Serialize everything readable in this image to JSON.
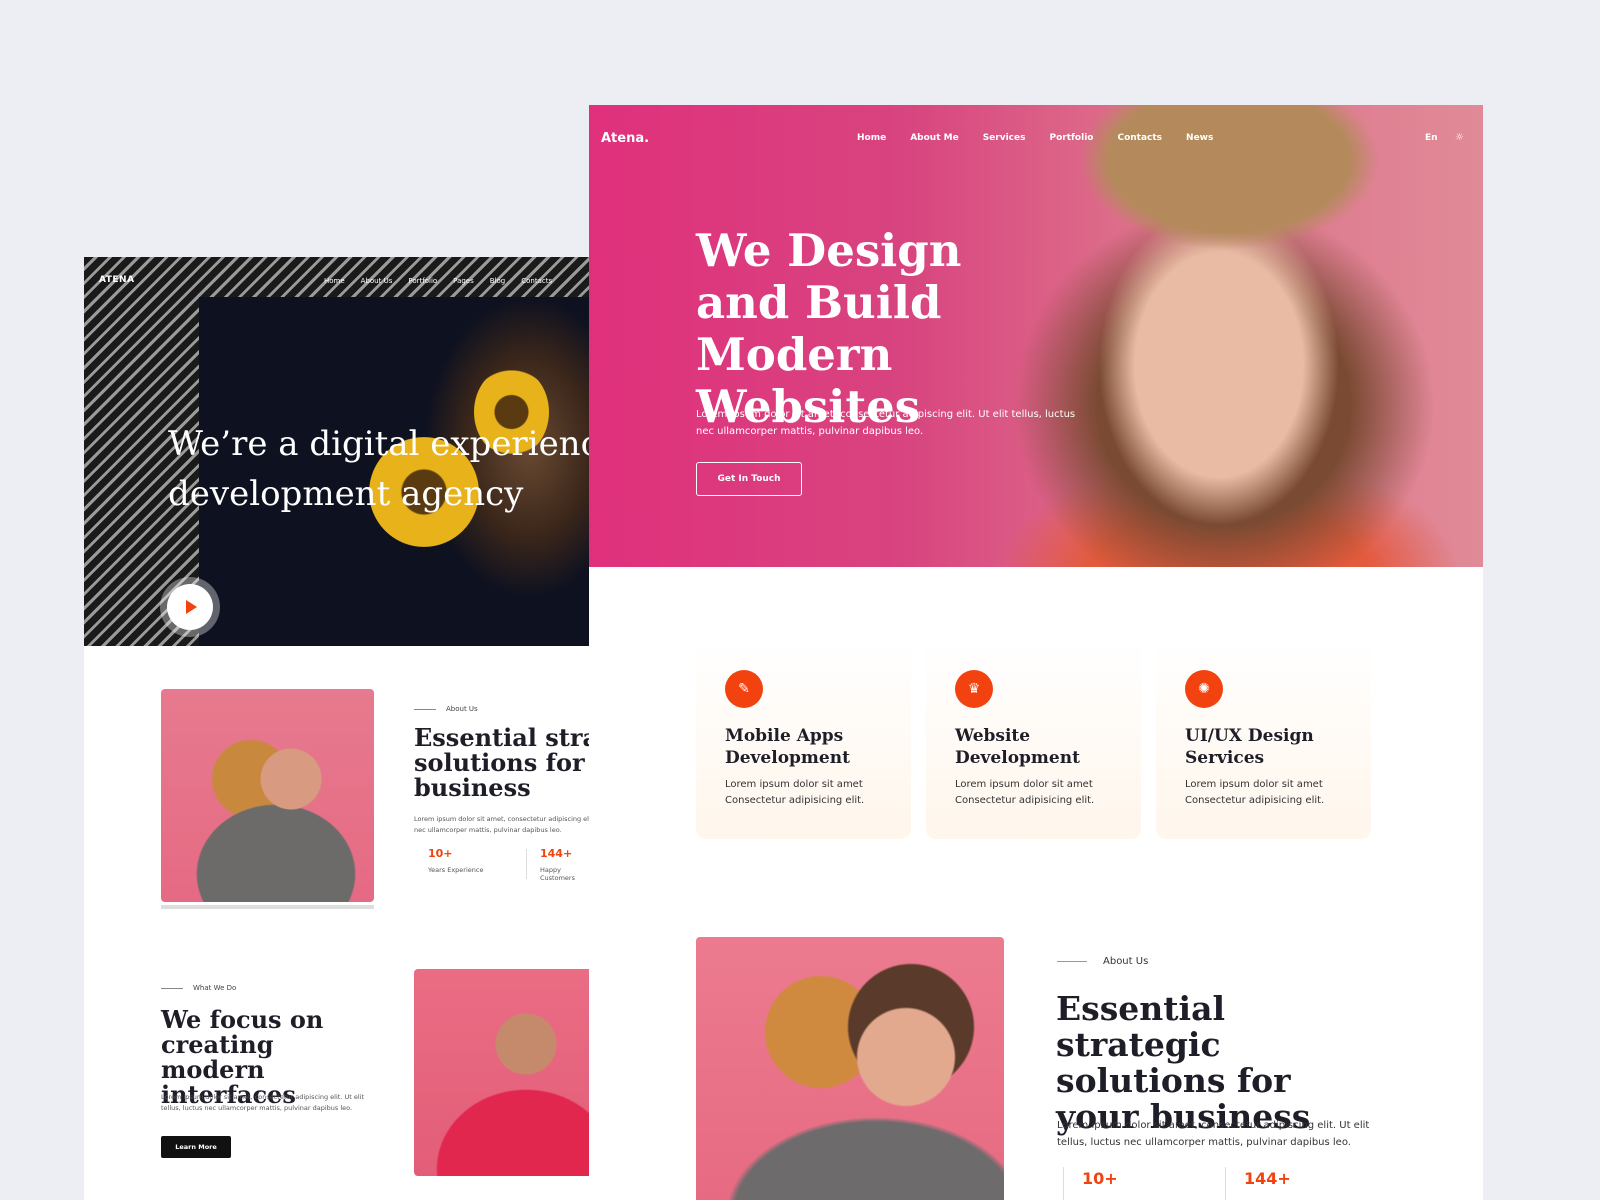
{
  "back": {
    "logo": "ATENA",
    "nav": [
      "Home",
      "About Us",
      "Portfolio",
      "Pages",
      "Blog",
      "Contacts"
    ],
    "hero_title": "We’re a digital experience development agency",
    "about": {
      "eyebrow": "About Us",
      "title": "Essential strategic solutions for your business",
      "text": "Lorem ipsum dolor sit amet, consectetur adipiscing elit. Ut elit tellus, luctus nec ullamcorper mattis, pulvinar dapibus leo.",
      "stats": [
        {
          "value": "10+",
          "label": "Years Experience"
        },
        {
          "value": "144+",
          "label": "Happy Customers"
        }
      ]
    },
    "what_we_do": {
      "eyebrow": "What We Do",
      "title": "We focus on creating modern interfaces",
      "text": "Lorem ipsum dolor sit amet, consectetur adipiscing elit. Ut elit tellus, luctus nec ullamcorper mattis, pulvinar dapibus leo.",
      "button": "Learn More"
    }
  },
  "front": {
    "logo": "Atena.",
    "nav": [
      "Home",
      "About Me",
      "Services",
      "Portfolio",
      "Contacts",
      "News"
    ],
    "lang": "En",
    "hero": {
      "title": "We Design and Build Modern Websites",
      "text": "Lorem ipsum dolor sit amet, consectetur adipiscing elit. Ut elit tellus, luctus nec ullamcorper mattis, pulvinar dapibus leo.",
      "button": "Get In Touch"
    },
    "services": [
      {
        "icon": "paint-bucket-icon",
        "glyph": "✎",
        "title": "Mobile Apps Development",
        "text": "Lorem ipsum dolor sit amet Consectetur adipisicing elit."
      },
      {
        "icon": "trophy-icon",
        "glyph": "♛",
        "title": "Website Development",
        "text": "Lorem ipsum dolor sit amet Consectetur adipisicing elit."
      },
      {
        "icon": "gear-icon",
        "glyph": "✺",
        "title": "UI/UX Design Services",
        "text": "Lorem ipsum dolor sit amet Consectetur adipisicing elit."
      }
    ],
    "about": {
      "eyebrow": "About Us",
      "title": "Essential strategic solutions for your business",
      "text": "Lorem ipsum dolor sit amet, consectetur adipiscing elit. Ut elit tellus, luctus nec ullamcorper mattis, pulvinar dapibus leo.",
      "stats": [
        "10+",
        "144+"
      ]
    }
  },
  "colors": {
    "accent": "#f1420f",
    "hero_pink": "#e0307c",
    "dark": "#1e1e28"
  }
}
